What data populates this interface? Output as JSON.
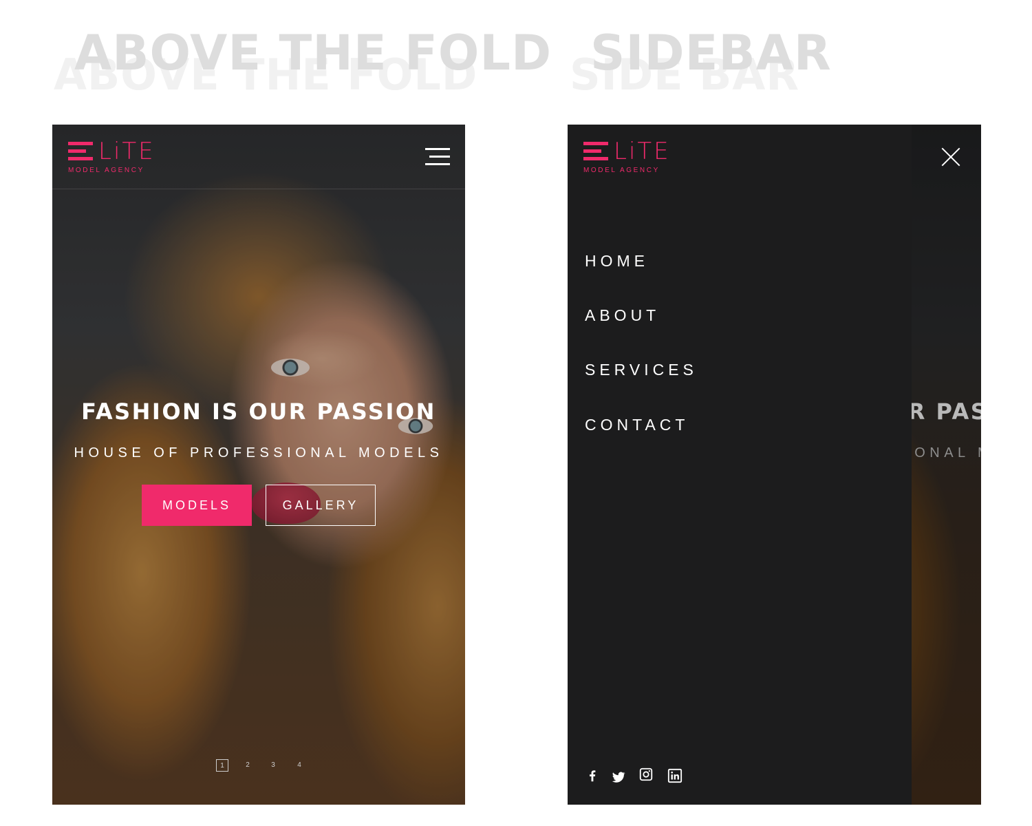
{
  "headings": {
    "left": "ABOVE THE FOLD",
    "right": "SIDEBAR"
  },
  "brand": {
    "name": "LiTE",
    "tagline": "MODEL AGENCY",
    "accent": "#f02a6b"
  },
  "hero": {
    "title": "FASHION IS OUR PASSION",
    "subtitle": "HOUSE OF PROFESSIONAL MODELS",
    "buttons": {
      "models": "MODELS",
      "gallery": "GALLERY"
    },
    "pages": [
      "1",
      "2",
      "3",
      "4"
    ],
    "active_page": "1"
  },
  "sidebar": {
    "nav": [
      "HOME",
      "ABOUT",
      "SERVICES",
      "CONTACT"
    ],
    "social": [
      "facebook-icon",
      "twitter-icon",
      "instagram-icon",
      "linkedin-icon"
    ],
    "background": "#1c1c1d"
  }
}
